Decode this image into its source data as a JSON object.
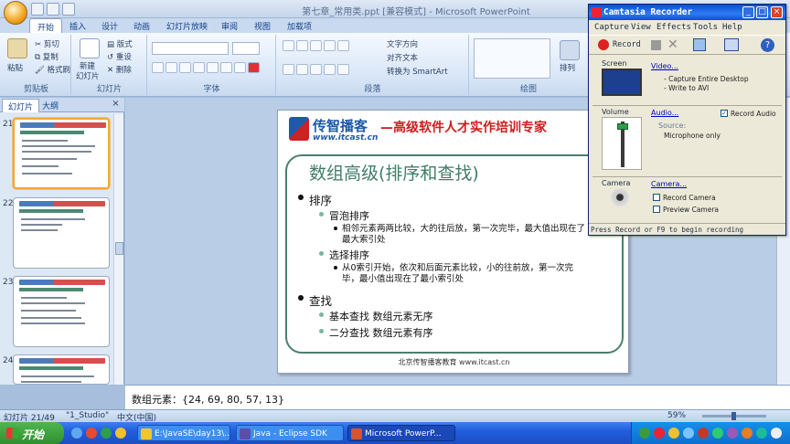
{
  "window": {
    "title": "第七章_常用类.ppt [兼容模式] - Microsoft PowerPoint"
  },
  "ribbon": {
    "tabs": [
      "开始",
      "插入",
      "设计",
      "动画",
      "幻灯片放映",
      "审阅",
      "视图",
      "加载项"
    ],
    "clipboard": {
      "paste": "粘贴",
      "cut": "剪切",
      "copy": "复制",
      "format_painter": "格式刷",
      "label": "剪贴板"
    },
    "slides": {
      "new_slide_1": "新建",
      "new_slide_2": "幻灯片",
      "layout": "版式",
      "reset": "重设",
      "delete": "删除",
      "label": "幻灯片"
    },
    "font": {
      "label": "字体"
    },
    "paragraph": {
      "text_direction": "文字方向",
      "align_text": "对齐文本",
      "smartart": "转换为 SmartArt",
      "label": "段落"
    },
    "drawing": {
      "arrange": "排列",
      "label": "绘图"
    }
  },
  "left_panel": {
    "tabs": [
      "幻灯片",
      "大纲"
    ],
    "close": "×",
    "thumbnails": [
      {
        "num": "21",
        "selected": true
      },
      {
        "num": "22",
        "selected": false
      },
      {
        "num": "23",
        "selected": false
      },
      {
        "num": "24",
        "selected": false
      }
    ]
  },
  "slide": {
    "logo_cn": "传智播客",
    "logo_url": "www.itcast.cn",
    "slogan": "—高级软件人才实作培训专家",
    "title": "数组高级(排序和查找)",
    "bullets": {
      "sort": "排序",
      "bubble": "冒泡排序",
      "bubble_desc": "相邻元素两两比较，大的往后放，第一次完毕，最大值出现在了最大索引处",
      "selection": "选择排序",
      "selection_desc": "从0索引开始，依次和后面元素比较，小的往前放，第一次完毕，最小值出现在了最小索引处",
      "search": "查找",
      "basic": "基本查找 数组元素无序",
      "binary": "二分查找 数组元素有序"
    },
    "footer": "北京传智播客教育 www.itcast.cn"
  },
  "notes": {
    "text": "数组元素：{24, 69, 80, 57, 13}"
  },
  "status": {
    "slide_counter": "幻灯片 21/49",
    "theme": "\"1_Studio\"",
    "language": "中文(中国)",
    "zoom": "59%",
    "zoom_level_pct": 59
  },
  "taskbar": {
    "start": "开始",
    "tasks": [
      {
        "label": "E:\\JavaSE\\day13\\...",
        "icon_color": "#f4c430"
      },
      {
        "label": "Java - Eclipse SDK",
        "icon_color": "#5b4fa8"
      },
      {
        "label": "Microsoft PowerP...",
        "icon_color": "#d9532c"
      }
    ]
  },
  "camtasia": {
    "title": "Camtasia Recorder",
    "menu": [
      "Capture",
      "View",
      "Effects",
      "Tools",
      "Help"
    ],
    "record_button": "Record",
    "screen": {
      "label": "Screen",
      "link": "Video...",
      "line1": "- Capture Entire Desktop",
      "line2": "- Write to AVI"
    },
    "volume": {
      "label": "Volume",
      "link": "Audio...",
      "record_audio": "Record Audio",
      "record_audio_checked": true,
      "source_label": "Source:",
      "source": "Microphone only"
    },
    "camera": {
      "label": "Camera",
      "link": "Camera...",
      "record_camera": "Record Camera",
      "preview_camera": "Preview Camera"
    },
    "status": "Press Record or F9 to begin recording"
  },
  "colors": {
    "accent": "#15428b",
    "slide_frame": "#4b7f6e",
    "slogan": "#d01c1c",
    "record": "#e02020"
  }
}
